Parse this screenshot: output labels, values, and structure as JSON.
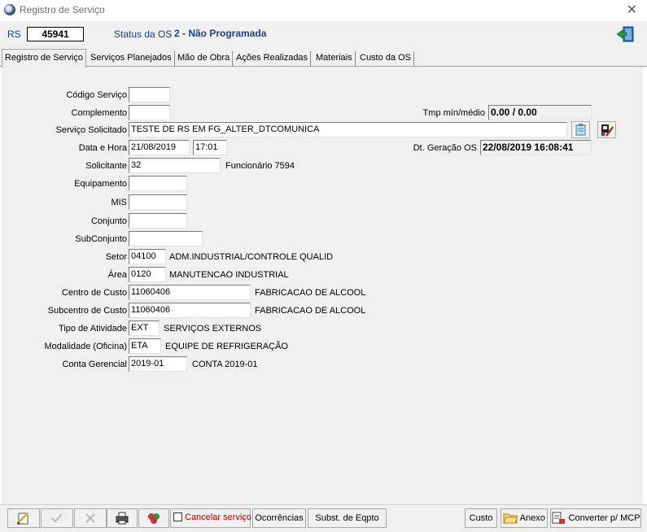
{
  "window": {
    "title": "Registro de Serviço"
  },
  "header": {
    "rs_label": "RS",
    "rs_value": "45941",
    "status_label": "Status da OS",
    "status_value": "2 - Não Programada"
  },
  "tabs": [
    {
      "label": "Registro de Serviço",
      "active": true
    },
    {
      "label": "Serviços Planejados"
    },
    {
      "label": "Mão de Obra"
    },
    {
      "label": "Ações Realizadas"
    },
    {
      "label": "Materiais"
    },
    {
      "label": "Custo da OS"
    }
  ],
  "form": {
    "codigo_servico": {
      "label": "Código Serviço",
      "value": ""
    },
    "complemento": {
      "label": "Complemento",
      "value": ""
    },
    "tmp_min_medio": {
      "label": "Tmp mín/médio",
      "value": "0.00 / 0.00"
    },
    "servico_solicitado": {
      "label": "Serviço Solicitado",
      "value": "TESTE DE RS EM FG_ALTER_DTCOMUNICA"
    },
    "data_hora": {
      "label": "Data e Hora",
      "date": "21/08/2019",
      "time": "17:01"
    },
    "dt_geracao": {
      "label": "Dt. Geração OS",
      "value": "22/08/2019 16:08:41"
    },
    "solicitante": {
      "label": "Solicitante",
      "value": "32",
      "desc": "Funcionário 7594"
    },
    "equipamento": {
      "label": "Equipamento",
      "value": ""
    },
    "mis": {
      "label": "MIS",
      "value": ""
    },
    "conjunto": {
      "label": "Conjunto",
      "value": ""
    },
    "subconjunto": {
      "label": "SubConjunto",
      "value": ""
    },
    "setor": {
      "label": "Setor",
      "value": "04100",
      "desc": "ADM.INDUSTRIAL/CONTROLE QUALID"
    },
    "area": {
      "label": "Área",
      "value": "0120",
      "desc": "MANUTENCAO INDUSTRIAL"
    },
    "centro_custo": {
      "label": "Centro de Custo",
      "value": "11060406",
      "desc": "FABRICACAO DE ALCOOL"
    },
    "subcentro_custo": {
      "label": "Subcentro de Custo",
      "value": "11060406",
      "desc": "FABRICACAO DE ALCOOL"
    },
    "tipo_atividade": {
      "label": "Tipo de Atividade",
      "value": "EXT",
      "desc": "SERVIÇOS EXTERNOS"
    },
    "modalidade": {
      "label": "Modalidade (Oficina)",
      "value": "ETA",
      "desc": "EQUIPE DE REFRIGERAÇÃO"
    },
    "conta_gerencial": {
      "label": "Conta Gerencial",
      "value": "2019-01",
      "desc": "CONTA 2019-01"
    }
  },
  "bottom": {
    "cancel_label": "Cancelar serviço",
    "ocorrencias": "Ocorrências",
    "subst_eqpto": "Subst. de Eqpto",
    "custo": "Custo",
    "anexo": "Anexo",
    "converter": "Converter p/ MCP"
  }
}
